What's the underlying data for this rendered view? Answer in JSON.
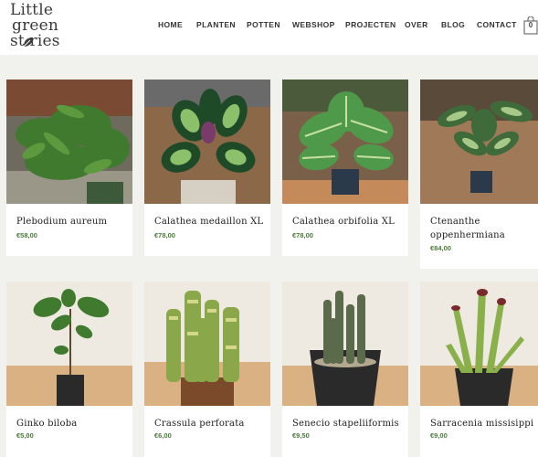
{
  "brand": {
    "line1": "Little",
    "line2": "green",
    "line3": "st  ries"
  },
  "nav": [
    {
      "label": "HOME"
    },
    {
      "label": "PLANTEN"
    },
    {
      "label": "POTTEN"
    },
    {
      "label": "WEBSHOP"
    },
    {
      "label": "PROJECTEN"
    },
    {
      "label": "OVER"
    },
    {
      "label": "BLOG"
    },
    {
      "label": "CONTACT"
    }
  ],
  "cart": {
    "count": "0"
  },
  "products": [
    {
      "name": "Plebodium aureum",
      "price": "€58,00"
    },
    {
      "name": "Calathea medaillon XL",
      "price": "€78,00"
    },
    {
      "name": "Calathea orbifolia XL",
      "price": "€78,00"
    },
    {
      "name": "Ctenanthe oppenhermiana",
      "price": "€84,00"
    },
    {
      "name": "Ginko biloba",
      "price": "€5,00"
    },
    {
      "name": "Crassula perforata",
      "price": "€6,00"
    },
    {
      "name": "Senecio stapeliiformis",
      "price": "€9,50"
    },
    {
      "name": "Sarracenia missisippi",
      "price": "€9,00"
    }
  ],
  "colors": {
    "accent": "#4a7a3a",
    "background": "#f1f1ee",
    "text": "#1d1d1d"
  }
}
